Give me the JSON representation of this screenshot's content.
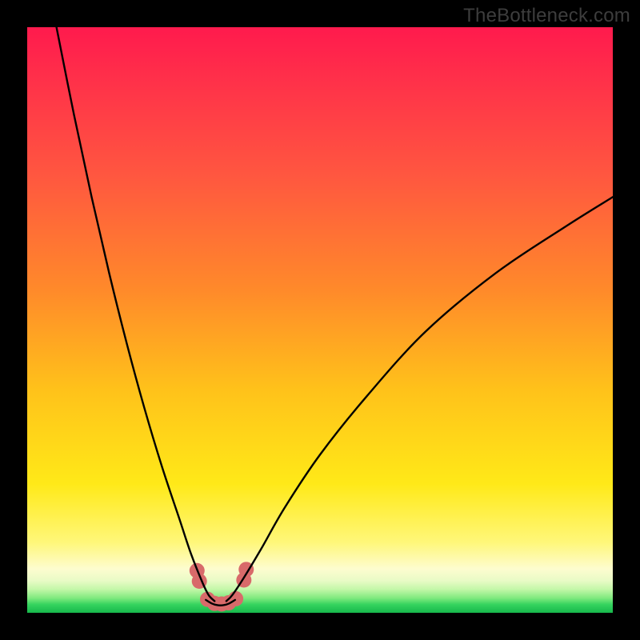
{
  "watermark": "TheBottleneck.com",
  "chart_data": {
    "type": "line",
    "title": "",
    "xlabel": "",
    "ylabel": "",
    "xlim": [
      0,
      100
    ],
    "ylim": [
      0,
      100
    ],
    "grid": false,
    "series": [
      {
        "name": "left-branch",
        "x": [
          5,
          8,
          11,
          14,
          17,
          20,
          23,
          26,
          28,
          30,
          31,
          32
        ],
        "y": [
          100,
          85,
          71,
          58,
          46,
          35,
          25,
          16,
          10,
          5,
          3,
          2
        ]
      },
      {
        "name": "right-branch",
        "x": [
          34,
          35,
          37,
          40,
          44,
          50,
          58,
          68,
          80,
          92,
          100
        ],
        "y": [
          2,
          3,
          6,
          11,
          18,
          27,
          37,
          48,
          58,
          66,
          71
        ]
      },
      {
        "name": "valley-floor",
        "x": [
          30.5,
          31.5,
          32.5,
          33.5,
          34.5,
          35.5
        ],
        "y": [
          2.2,
          1.6,
          1.3,
          1.3,
          1.6,
          2.2
        ]
      }
    ],
    "markers": {
      "name": "valley-dots",
      "color": "#d86a6a",
      "points": [
        {
          "x": 29.0,
          "y": 7.2
        },
        {
          "x": 29.4,
          "y": 5.4
        },
        {
          "x": 30.8,
          "y": 2.3
        },
        {
          "x": 32.0,
          "y": 1.6
        },
        {
          "x": 33.2,
          "y": 1.5
        },
        {
          "x": 34.4,
          "y": 1.7
        },
        {
          "x": 35.6,
          "y": 2.4
        },
        {
          "x": 37.0,
          "y": 5.6
        },
        {
          "x": 37.4,
          "y": 7.4
        }
      ]
    },
    "gradient_stops": [
      {
        "pos": 0.0,
        "color": "#ff1a4d"
      },
      {
        "pos": 0.25,
        "color": "#ff5640"
      },
      {
        "pos": 0.62,
        "color": "#ffc21a"
      },
      {
        "pos": 0.88,
        "color": "#fff77a"
      },
      {
        "pos": 0.965,
        "color": "#9ef191"
      },
      {
        "pos": 1.0,
        "color": "#17b84c"
      }
    ]
  }
}
